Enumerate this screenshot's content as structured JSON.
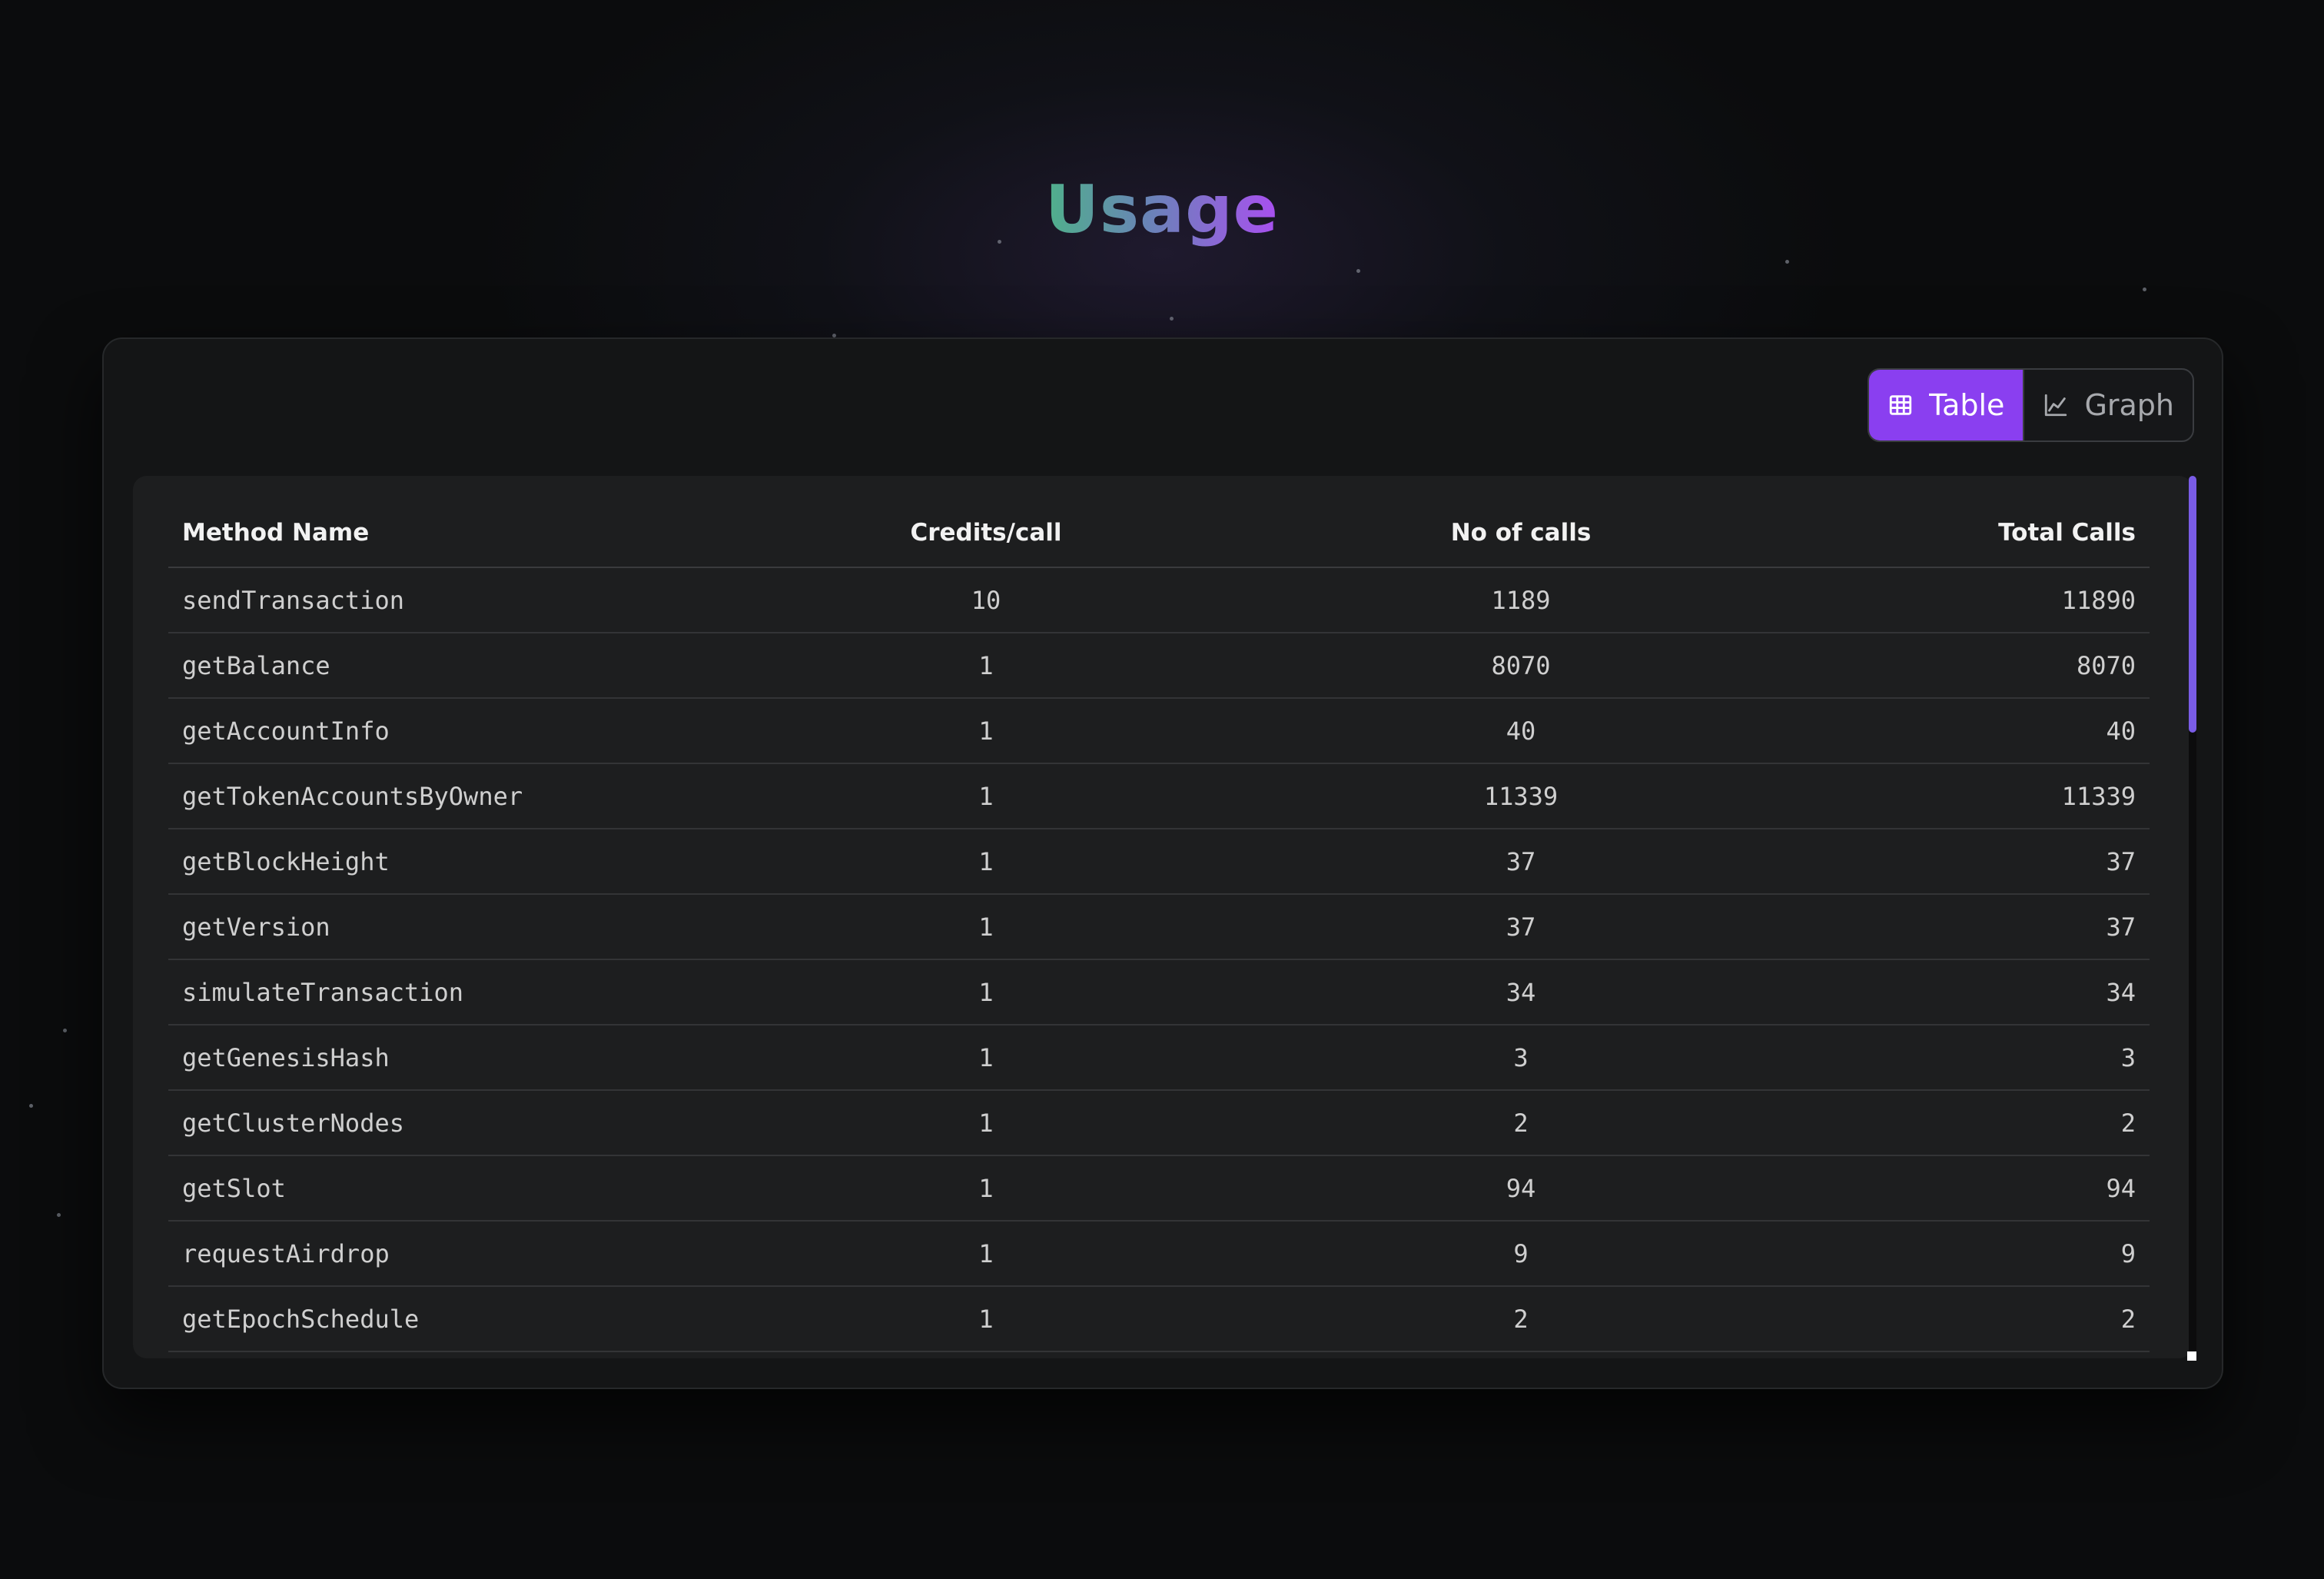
{
  "page": {
    "title": "Usage"
  },
  "view_toggle": {
    "table_label": "Table",
    "graph_label": "Graph",
    "active": "Table",
    "table_icon": "table-grid-icon",
    "graph_icon": "line-chart-icon"
  },
  "table": {
    "headers": {
      "method": "Method Name",
      "credits": "Credits/call",
      "calls": "No of calls",
      "total": "Total Calls"
    },
    "rows": [
      {
        "method": "sendTransaction",
        "credits": "10",
        "calls": "1189",
        "total": "11890"
      },
      {
        "method": "getBalance",
        "credits": "1",
        "calls": "8070",
        "total": "8070"
      },
      {
        "method": "getAccountInfo",
        "credits": "1",
        "calls": "40",
        "total": "40"
      },
      {
        "method": "getTokenAccountsByOwner",
        "credits": "1",
        "calls": "11339",
        "total": "11339"
      },
      {
        "method": "getBlockHeight",
        "credits": "1",
        "calls": "37",
        "total": "37"
      },
      {
        "method": "getVersion",
        "credits": "1",
        "calls": "37",
        "total": "37"
      },
      {
        "method": "simulateTransaction",
        "credits": "1",
        "calls": "34",
        "total": "34"
      },
      {
        "method": "getGenesisHash",
        "credits": "1",
        "calls": "3",
        "total": "3"
      },
      {
        "method": "getClusterNodes",
        "credits": "1",
        "calls": "2",
        "total": "2"
      },
      {
        "method": "getSlot",
        "credits": "1",
        "calls": "94",
        "total": "94"
      },
      {
        "method": "requestAirdrop",
        "credits": "1",
        "calls": "9",
        "total": "9"
      },
      {
        "method": "getEpochSchedule",
        "credits": "1",
        "calls": "2",
        "total": "2"
      }
    ]
  },
  "colors": {
    "background": "#0b0c0d",
    "accent": "#8a3ff0",
    "scrollbar": "#7a5ce6",
    "title_gradient_start": "#4fb08a",
    "title_gradient_end": "#a94ff0"
  }
}
